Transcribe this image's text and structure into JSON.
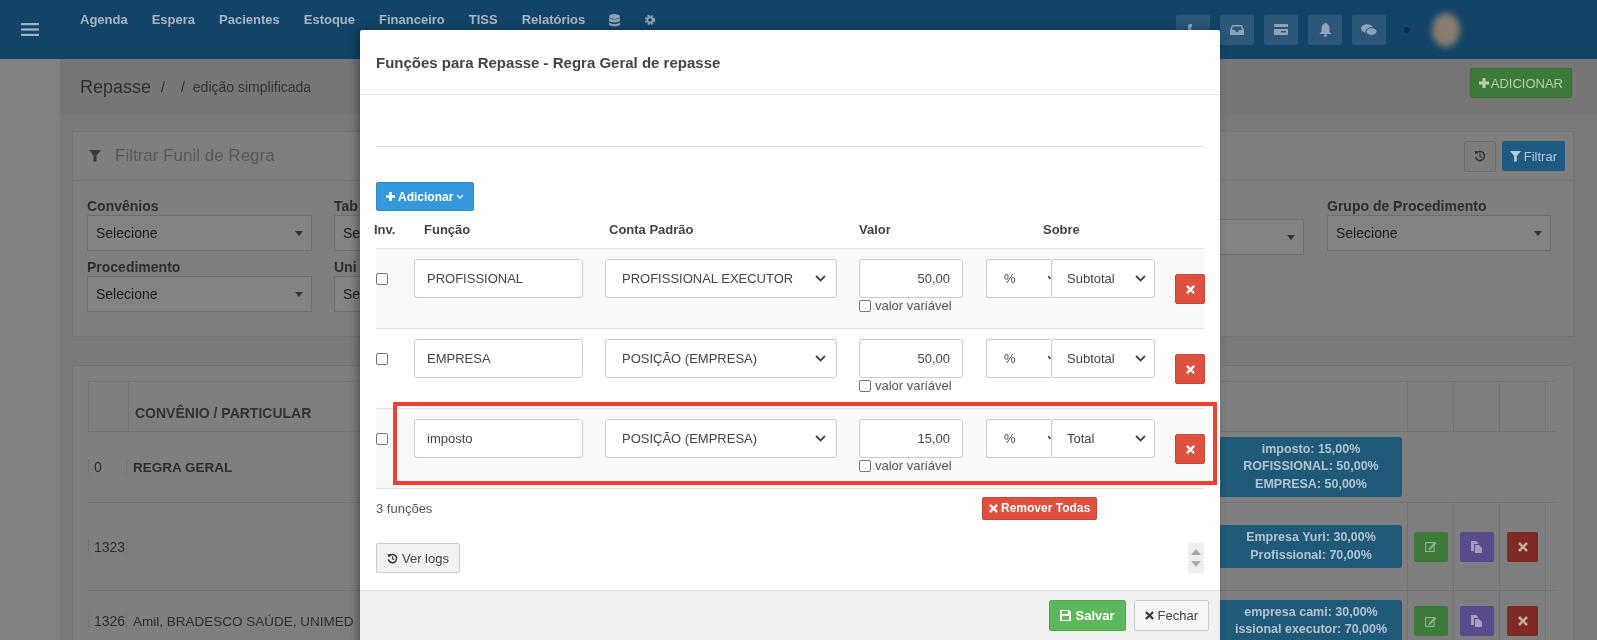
{
  "topbar": {
    "nav": [
      "Agenda",
      "Espera",
      "Pacientes",
      "Estoque",
      "Financeiro",
      "TISS",
      "Relatórios"
    ]
  },
  "breadcrumb": {
    "title": "Repasse",
    "separators": [
      "/",
      "/"
    ],
    "current": "edição simplificada"
  },
  "add_button": "ADICIONAR",
  "filter": {
    "title": "Filtrar Funil de Regra",
    "filter_button": "Filtrar",
    "fields": [
      {
        "label": "Convênios",
        "value": "Selecione"
      },
      {
        "label": "Procedimento",
        "value": "Selecione"
      }
    ],
    "cut_fields": [
      {
        "label": "Tab",
        "value": "Se"
      },
      {
        "label": "Uni",
        "value": "Se"
      }
    ],
    "right_fields": [
      {
        "label": "Grupo de Procedimento",
        "value": "Selecione"
      }
    ]
  },
  "table": {
    "columns": [
      "CONVÊNIO / PARTICULAR"
    ],
    "rows": [
      {
        "id": "0",
        "name": "REGRA GERAL",
        "splits": [
          "imposto: 15,00%",
          "ROFISSIONAL: 50,00%",
          "EMPRESA: 50,00%"
        ],
        "actions": false
      },
      {
        "id": "1323",
        "splits": [
          "Empresa Yuri: 30,00%",
          "Profissional: 70,00%"
        ],
        "actions": true
      },
      {
        "id": "1326",
        "name": "Amil, BRADESCO SAÚDE, UNIMED",
        "splits": [
          "empresa cami: 30,00%",
          "issional executor: 70,00%"
        ],
        "actions": true
      }
    ]
  },
  "modal": {
    "title": "Funções para Repasse - Regra Geral de repasse",
    "add_button": "Adicionar",
    "columns": [
      "Inv.",
      "Função",
      "Conta Padrão",
      "Valor",
      "Sobre"
    ],
    "rows": [
      {
        "inverted": false,
        "function": "PROFISSIONAL",
        "account": "PROFISSIONAL EXECUTOR",
        "value": "50,00",
        "unit": "%",
        "variable": false,
        "variable_label": "valor variável",
        "base": "Subtotal",
        "highlighted": false
      },
      {
        "inverted": false,
        "function": "EMPRESA",
        "account": "POSIÇÃO (EMPRESA)",
        "value": "50,00",
        "unit": "%",
        "variable": false,
        "variable_label": "valor variável",
        "base": "Subtotal",
        "highlighted": false
      },
      {
        "inverted": false,
        "function": "imposto",
        "account": "POSIÇÃO (EMPRESA)",
        "value": "15,00",
        "unit": "%",
        "variable": false,
        "variable_label": "valor variável",
        "base": "Total",
        "highlighted": true
      }
    ],
    "count": "3 funções",
    "remove_all": "Remover Todas",
    "logs_button": "Ver logs",
    "save_button": "Salvar",
    "close_button": "Fechar"
  }
}
